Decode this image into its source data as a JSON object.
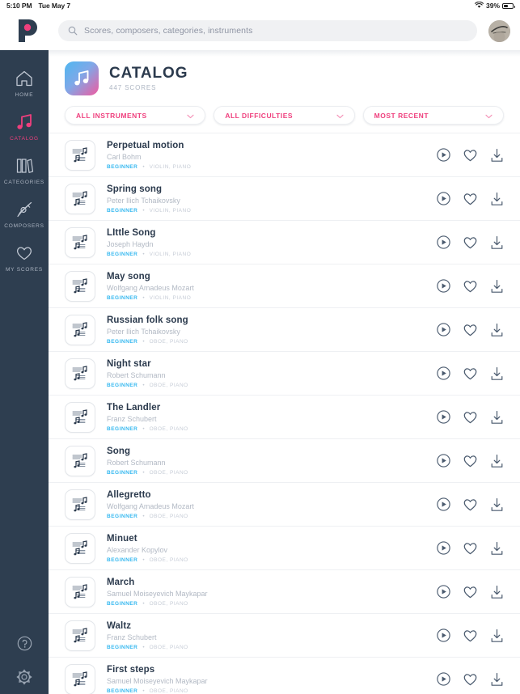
{
  "status_bar": {
    "time": "5:10 PM",
    "date": "Tue May 7",
    "wifi_icon": "wifi-icon",
    "battery_percent": "39%",
    "battery_icon": "battery-icon"
  },
  "top_bar": {
    "logo": "app-logo-p",
    "search": {
      "icon": "search-icon",
      "placeholder": "Scores, composers, categories, instruments",
      "value": ""
    },
    "avatar": "user-avatar"
  },
  "sidebar": {
    "items": [
      {
        "label": "HOME",
        "icon": "home-icon",
        "active": false
      },
      {
        "label": "CATALOG",
        "icon": "music-note-icon",
        "active": true
      },
      {
        "label": "CATEGORIES",
        "icon": "books-icon",
        "active": false
      },
      {
        "label": "COMPOSERS",
        "icon": "fountain-pen-icon",
        "active": false
      },
      {
        "label": "MY SCORES",
        "icon": "heart-icon",
        "active": false
      }
    ],
    "bottom_items": [
      {
        "label": "Help",
        "icon": "help-circle-icon"
      },
      {
        "label": "Settings",
        "icon": "gear-icon"
      }
    ]
  },
  "page": {
    "icon": "catalog-music-icon",
    "title": "CATALOG",
    "count": "447",
    "count_unit": "SCORES"
  },
  "filters": [
    {
      "name": "instruments",
      "label": "ALL INSTRUMENTS",
      "chevron": "chevron-down-icon"
    },
    {
      "name": "difficulties",
      "label": "ALL DIFFICULTIES",
      "chevron": "chevron-down-icon"
    },
    {
      "name": "sort",
      "label": "MOST RECENT",
      "chevron": "chevron-down-icon"
    }
  ],
  "row_actions": {
    "play": "play-circle-icon",
    "favorite": "heart-icon",
    "download": "download-icon"
  },
  "scores": [
    {
      "title": "Perpetual motion",
      "composer": "Carl Bohm",
      "difficulty": "BEGINNER",
      "instruments": "VIOLIN, PIANO"
    },
    {
      "title": "Spring song",
      "composer": "Peter Ilich Tchaikovsky",
      "difficulty": "BEGINNER",
      "instruments": "VIOLIN, PIANO"
    },
    {
      "title": "LIttle Song",
      "composer": "Joseph Haydn",
      "difficulty": "BEGINNER",
      "instruments": "VIOLIN, PIANO"
    },
    {
      "title": "May song",
      "composer": "Wolfgang Amadeus Mozart",
      "difficulty": "BEGINNER",
      "instruments": "VIOLIN, PIANO"
    },
    {
      "title": "Russian folk song",
      "composer": "Peter Ilich Tchaikovsky",
      "difficulty": "BEGINNER",
      "instruments": "OBOE, PIANO"
    },
    {
      "title": "Night star",
      "composer": "Robert Schumann",
      "difficulty": "BEGINNER",
      "instruments": "OBOE, PIANO"
    },
    {
      "title": "The Landler",
      "composer": "Franz Schubert",
      "difficulty": "BEGINNER",
      "instruments": "OBOE, PIANO"
    },
    {
      "title": "Song",
      "composer": "Robert Schumann",
      "difficulty": "BEGINNER",
      "instruments": "OBOE, PIANO"
    },
    {
      "title": "Allegretto",
      "composer": "Wolfgang Amadeus Mozart",
      "difficulty": "BEGINNER",
      "instruments": "OBOE, PIANO"
    },
    {
      "title": "Minuet",
      "composer": "Alexander Kopylov",
      "difficulty": "BEGINNER",
      "instruments": "OBOE, PIANO"
    },
    {
      "title": "March",
      "composer": "Samuel Moiseyevich Maykapar",
      "difficulty": "BEGINNER",
      "instruments": "OBOE, PIANO"
    },
    {
      "title": "Waltz",
      "composer": "Franz Schubert",
      "difficulty": "BEGINNER",
      "instruments": "OBOE, PIANO"
    },
    {
      "title": "First steps",
      "composer": "Samuel Moiseyevich Maykapar",
      "difficulty": "BEGINNER",
      "instruments": "OBOE, PIANO"
    }
  ],
  "colors": {
    "sidebar_bg": "#2e3e50",
    "accent_pink": "#ef3f7d",
    "difficulty_blue": "#35b8f0",
    "title_navy": "#2b3a4d",
    "muted_gray": "#b2b9c4"
  },
  "separator_dot": "•"
}
